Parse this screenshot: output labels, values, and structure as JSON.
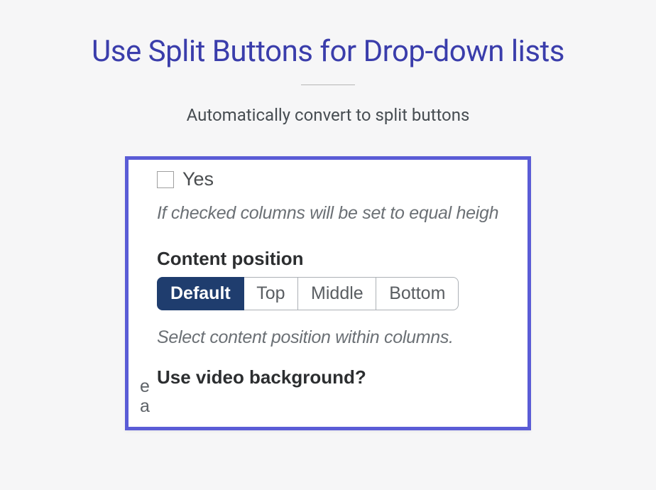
{
  "title": "Use Split Buttons for Drop-down lists",
  "subtitle": "Automatically convert to split buttons",
  "screenshot": {
    "checkbox_label": "Yes",
    "checkbox_help": "If checked columns will be set to equal heigh",
    "section_heading": "Content position",
    "split_options": [
      "Default",
      "Top",
      "Middle",
      "Bottom"
    ],
    "split_active_index": 0,
    "section_help": "Select content position within columns.",
    "next_heading": "Use video background?",
    "left_edge_0": "e",
    "left_edge_1": "a"
  }
}
